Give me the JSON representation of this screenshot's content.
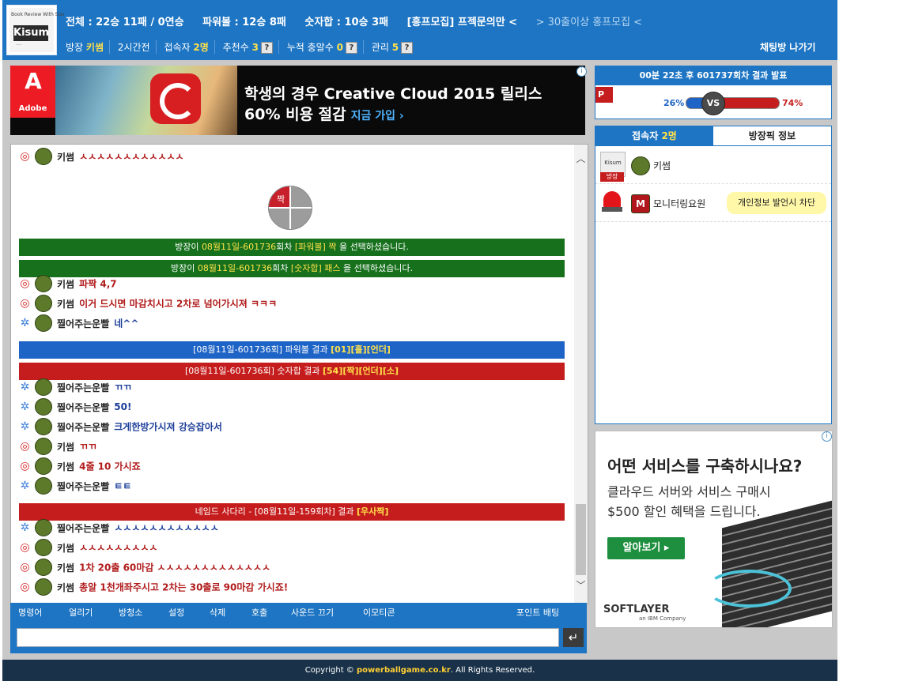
{
  "header": {
    "logo": {
      "tiny_text": "Book Review With Star",
      "name": "Kisum",
      "sub": "····"
    },
    "stats": [
      "전체 : 22승 11패 / 0연승",
      "파워볼 : 12승 8패",
      "숫자합 : 10승 3패",
      "[홍프모집] 프젝문의만 <",
      "> 30출이상 홍프모집 <"
    ],
    "info": {
      "owner_label": "방장",
      "owner_name": "키썸",
      "duration": "2시간전",
      "online_label": "접속자",
      "online_count": "2명",
      "recommend_label": "추천수",
      "recommend_count": "3",
      "accum_label": "누적 충알수",
      "accum_count": "0",
      "manage_label": "관리",
      "manage_count": "5",
      "help_glyph": "?"
    },
    "exit_label": "채팅방 나가기"
  },
  "ad_top": {
    "brand": "Adobe",
    "line1": "학생의 경우 Creative Cloud 2015 릴리스",
    "line2": "60% 비용 절감",
    "cta": "지금 가입 ›",
    "info_icon": "i"
  },
  "chat": {
    "pie_label": "짝",
    "messages": [
      {
        "type": "msg",
        "icon": "r",
        "user": "키썸",
        "text": "ㅅㅅㅅㅅㅅㅅㅅㅅㅅㅅㅅㅅ",
        "color": "red"
      },
      {
        "type": "banner",
        "style": "green",
        "parts": [
          "방장이 ",
          "08월11일-601736",
          "회차 ",
          "[파워볼] 짝",
          " 을 선택하셨습니다."
        ]
      },
      {
        "type": "banner",
        "style": "green",
        "parts": [
          "방장이 ",
          "08월11일-601736",
          "회차 ",
          "[숫자합] 패스",
          " 을 선택하셨습니다."
        ]
      },
      {
        "type": "msg",
        "icon": "r",
        "user": "키썸",
        "text": "파짝 4,7",
        "color": "red"
      },
      {
        "type": "msg",
        "icon": "r",
        "user": "키썸",
        "text": "이거 드시면 마감치시고 2차로 넘어가시져 ㅋㅋㅋ",
        "color": "red"
      },
      {
        "type": "msg",
        "icon": "b",
        "user": "찔어주는운빨",
        "text": "네^^",
        "color": "blue"
      },
      {
        "type": "banner",
        "style": "blue",
        "parts": [
          "[08월11일-601736회] 파워볼 결과 ",
          "[01][홀][언더]"
        ]
      },
      {
        "type": "banner",
        "style": "red",
        "parts": [
          "[08월11일-601736회] 숫자합 결과 ",
          "[54][짝][언더][소]"
        ]
      },
      {
        "type": "msg",
        "icon": "b",
        "user": "찔어주는운빨",
        "text": "ㄲㄲ",
        "color": "blue"
      },
      {
        "type": "msg",
        "icon": "b",
        "user": "찔어주는운빨",
        "text": "50!",
        "color": "blue"
      },
      {
        "type": "msg",
        "icon": "b",
        "user": "찔어주는운빨",
        "text": "크게한방가시져 강승잡아서",
        "color": "blue"
      },
      {
        "type": "msg",
        "icon": "r",
        "user": "키썸",
        "text": "ㄲㄲ",
        "color": "red"
      },
      {
        "type": "msg",
        "icon": "r",
        "user": "키썸",
        "text": "4줄 10 가시죠",
        "color": "red"
      },
      {
        "type": "msg",
        "icon": "b",
        "user": "찔어주는운빨",
        "text": "ㅌㅌ",
        "color": "blue"
      },
      {
        "type": "banner",
        "style": "red",
        "parts": [
          "네임드 사다리 - [08월11일-159회차] 결과 ",
          "[우사짝]"
        ]
      },
      {
        "type": "msg",
        "icon": "b",
        "user": "찔어주는운빨",
        "text": "ㅅㅅㅅㅅㅅㅅㅅㅅㅅㅅㅅㅅ",
        "color": "blue"
      },
      {
        "type": "msg",
        "icon": "r",
        "user": "키썸",
        "text": "ㅅㅅㅅㅅㅅㅅㅅㅅㅅ",
        "color": "red"
      },
      {
        "type": "msg",
        "icon": "r",
        "user": "키썸",
        "text": "1차 20출 60마감 ㅅㅅㅅㅅㅅㅅㅅㅅㅅㅅㅅㅅㅅ",
        "color": "red"
      },
      {
        "type": "msg",
        "icon": "r",
        "user": "키썸",
        "text": "총알 1천개좌주시고 2차는 30출로 90마감 가시죠!",
        "color": "red"
      }
    ],
    "scroll_up": "︿",
    "scroll_down": "﹀"
  },
  "toolbar": {
    "items": [
      "명령어",
      "얼리기",
      "방청소",
      "설정",
      "삭제",
      "호출",
      "사운드 끄기",
      "이모티콘"
    ],
    "point": "포인트 배팅"
  },
  "input": {
    "value": "",
    "placeholder": "",
    "send_glyph": "↵"
  },
  "round": {
    "title": "00분 22초 후 601737회차 결과 발표",
    "flag": "P",
    "left_pct": "26%",
    "right_pct": "74%",
    "left_fraction": 0.26,
    "vs": "VS"
  },
  "users": {
    "tab_users_label": "접속자",
    "tab_users_count": "2명",
    "tab_owner": "방장픽 정보",
    "rows": [
      {
        "name": "키썸",
        "badge": "방장",
        "pic_text": "Kisum"
      },
      {
        "name": "모니터링요원",
        "avatar_letter": "M"
      }
    ],
    "block_tip": "개인정보 발언시 차단"
  },
  "ad_side": {
    "h1": "어떤 서비스를 구축하시나요?",
    "h2": "클라우드 서버와 서비스 구매시",
    "h3": "$500 할인 혜택을 드립니다.",
    "cta": "알아보기 ▸",
    "brand": "SOFTLAYER",
    "brand_sub": "an IBM Company",
    "info_icon": "i"
  },
  "footer": {
    "prefix": "Copyright © ",
    "site": "powerballgame.co.kr",
    "suffix": ". All Rights Reserved."
  }
}
